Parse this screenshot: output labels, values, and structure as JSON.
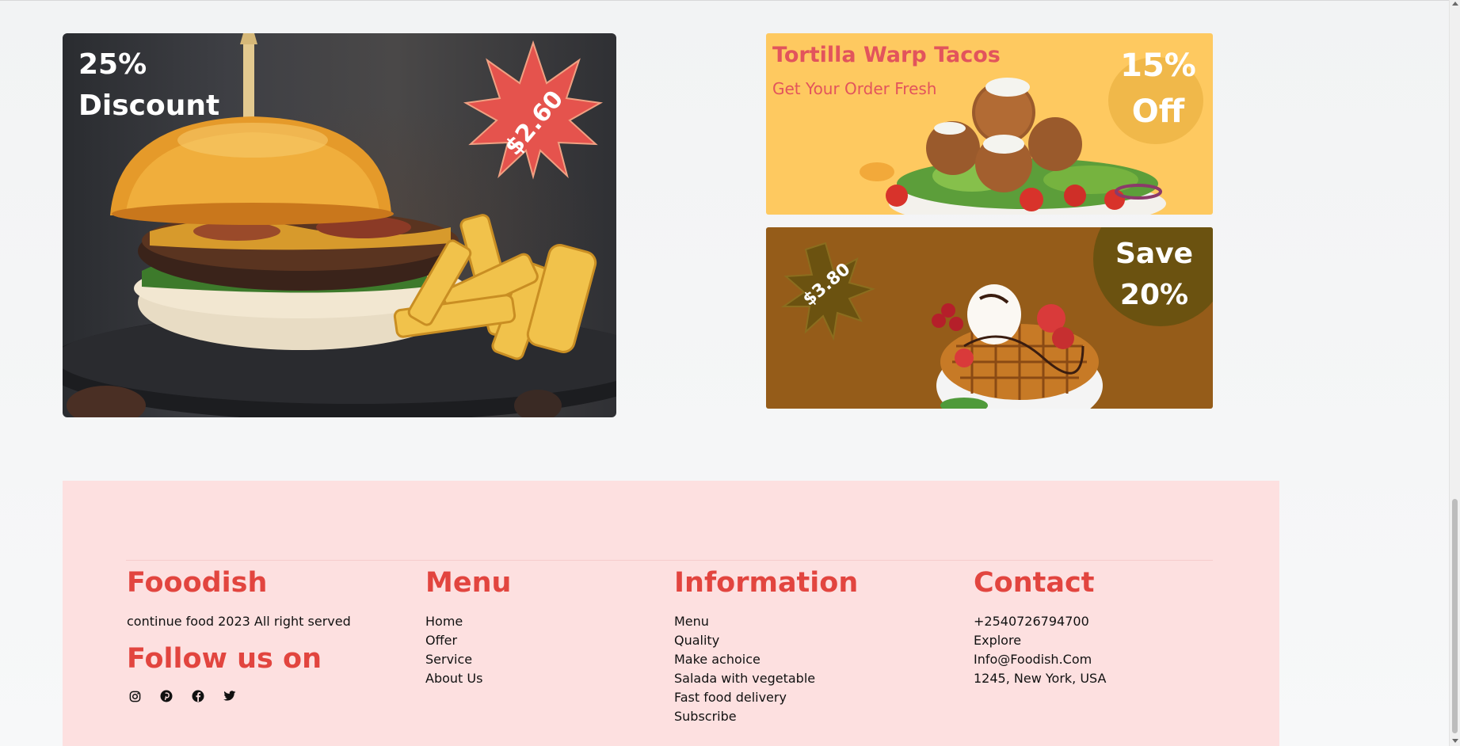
{
  "promos": {
    "burger": {
      "discount_line1": "25%",
      "discount_line2": "Discount",
      "price": "$2.60"
    },
    "tacos": {
      "title": "Tortilla Warp Tacos",
      "subtitle": "Get Your Order Fresh",
      "off_line1": "15%",
      "off_line2": "Off"
    },
    "waffle": {
      "price": "$3.80",
      "save_line1": "Save",
      "save_line2": "20%"
    }
  },
  "footer": {
    "brand": {
      "title": "Fooodish",
      "copyright": "continue food 2023 All right served",
      "follow_title": "Follow us on",
      "social": [
        "instagram-icon",
        "pinterest-icon",
        "facebook-icon",
        "twitter-icon"
      ]
    },
    "menu": {
      "title": "Menu",
      "links": [
        "Home",
        "Offer",
        "Service",
        "About Us"
      ]
    },
    "information": {
      "title": "Information",
      "links": [
        "Menu",
        "Quality",
        "Make achoice",
        "Salada with vegetable",
        "Fast food delivery",
        "Subscribe"
      ]
    },
    "contact": {
      "title": "Contact",
      "items": [
        "+2540726794700",
        "Explore",
        "Info@Foodish.Com",
        "1245, New York, USA"
      ]
    }
  },
  "colors": {
    "accent": "#e2453f",
    "footer_bg": "#fde0e0",
    "tacos_bg": "#fec960",
    "waffle_bg": "#955c19",
    "star_red": "#e5534d",
    "star_olive": "#6b5210"
  }
}
